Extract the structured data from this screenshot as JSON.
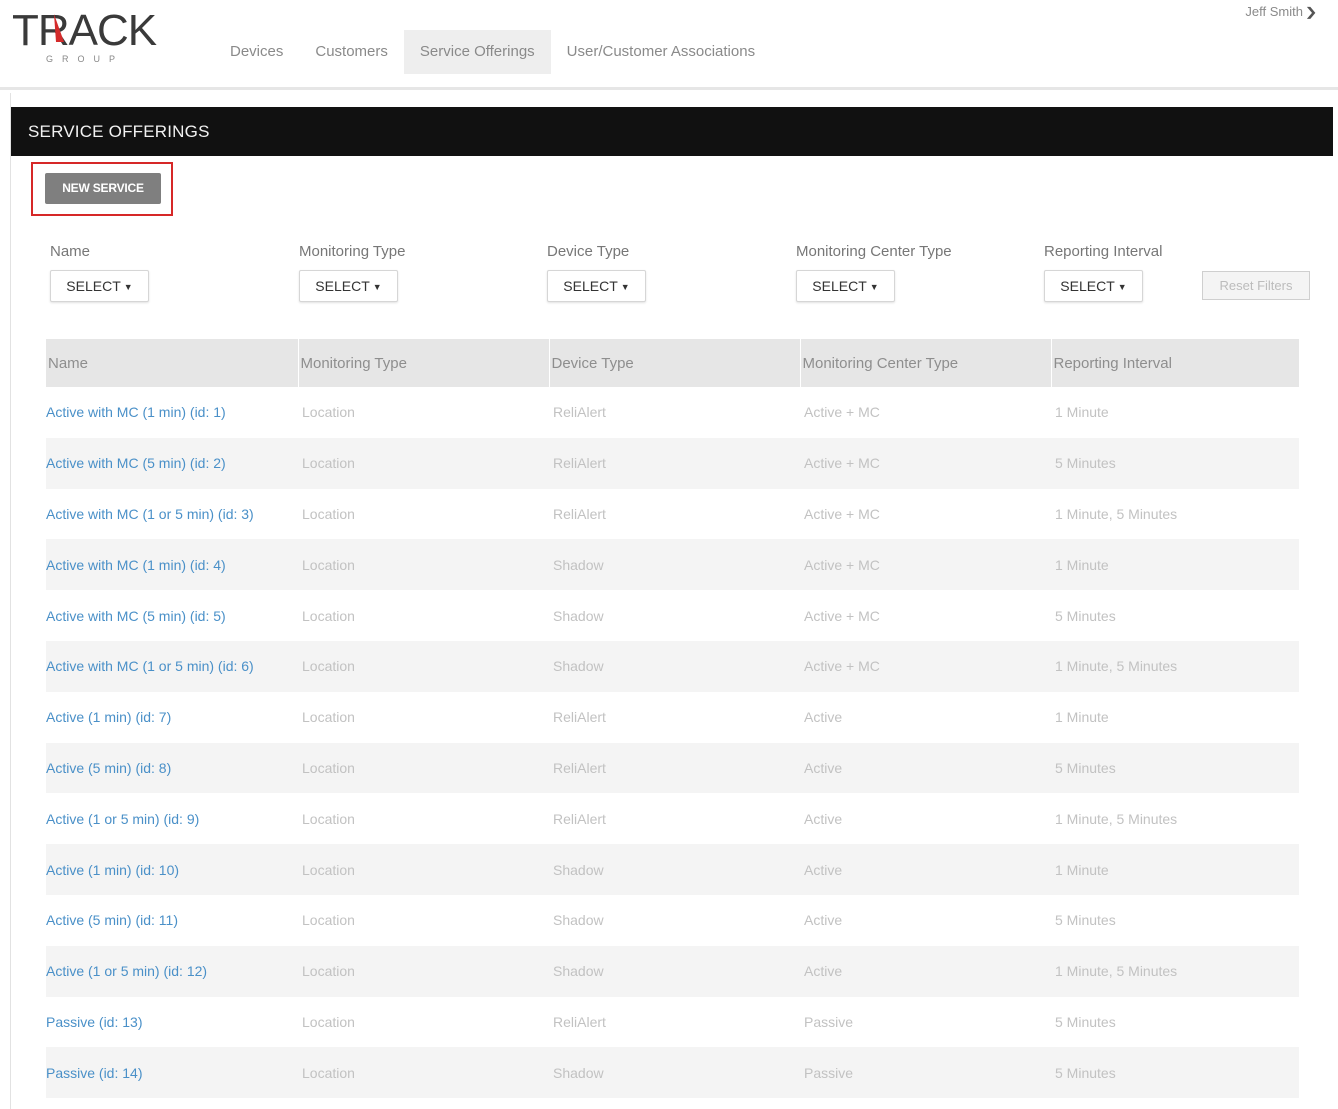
{
  "header": {
    "logo_text": "TRACK",
    "logo_sub": "GROUP",
    "nav": [
      {
        "label": "Devices",
        "active": false
      },
      {
        "label": "Customers",
        "active": false
      },
      {
        "label": "Service Offerings",
        "active": true
      },
      {
        "label": "User/Customer Associations",
        "active": false
      }
    ],
    "user_name": "Jeff Smith"
  },
  "panel": {
    "title": "SERVICE OFFERINGS",
    "new_button": "NEW SERVICE"
  },
  "filters": [
    {
      "label": "Name",
      "value": "SELECT"
    },
    {
      "label": "Monitoring Type",
      "value": "SELECT"
    },
    {
      "label": "Device Type",
      "value": "SELECT"
    },
    {
      "label": "Monitoring Center Type",
      "value": "SELECT"
    },
    {
      "label": "Reporting Interval",
      "value": "SELECT"
    }
  ],
  "reset_label": "Reset Filters",
  "table": {
    "columns": [
      "Name",
      "Monitoring Type",
      "Device Type",
      "Monitoring Center Type",
      "Reporting Interval"
    ],
    "rows": [
      [
        "Active with MC (1 min) (id: 1)",
        "Location",
        "ReliAlert",
        "Active + MC",
        "1 Minute"
      ],
      [
        "Active with MC (5 min) (id: 2)",
        "Location",
        "ReliAlert",
        "Active + MC",
        "5 Minutes"
      ],
      [
        "Active with MC (1 or 5 min) (id: 3)",
        "Location",
        "ReliAlert",
        "Active + MC",
        "1 Minute, 5 Minutes"
      ],
      [
        "Active with MC (1 min) (id: 4)",
        "Location",
        "Shadow",
        "Active + MC",
        "1 Minute"
      ],
      [
        "Active with MC (5 min) (id: 5)",
        "Location",
        "Shadow",
        "Active + MC",
        "5 Minutes"
      ],
      [
        "Active with MC (1 or 5 min) (id: 6)",
        "Location",
        "Shadow",
        "Active + MC",
        "1 Minute, 5 Minutes"
      ],
      [
        "Active (1 min) (id: 7)",
        "Location",
        "ReliAlert",
        "Active",
        "1 Minute"
      ],
      [
        "Active (5 min) (id: 8)",
        "Location",
        "ReliAlert",
        "Active",
        "5 Minutes"
      ],
      [
        "Active (1 or 5 min) (id: 9)",
        "Location",
        "ReliAlert",
        "Active",
        "1 Minute, 5 Minutes"
      ],
      [
        "Active (1 min) (id: 10)",
        "Location",
        "Shadow",
        "Active",
        "1 Minute"
      ],
      [
        "Active (5 min) (id: 11)",
        "Location",
        "Shadow",
        "Active",
        "5 Minutes"
      ],
      [
        "Active (1 or 5 min) (id: 12)",
        "Location",
        "Shadow",
        "Active",
        "1 Minute, 5 Minutes"
      ],
      [
        "Passive (id: 13)",
        "Location",
        "ReliAlert",
        "Passive",
        "5 Minutes"
      ],
      [
        "Passive (id: 14)",
        "Location",
        "Shadow",
        "Passive",
        "5 Minutes"
      ]
    ]
  }
}
